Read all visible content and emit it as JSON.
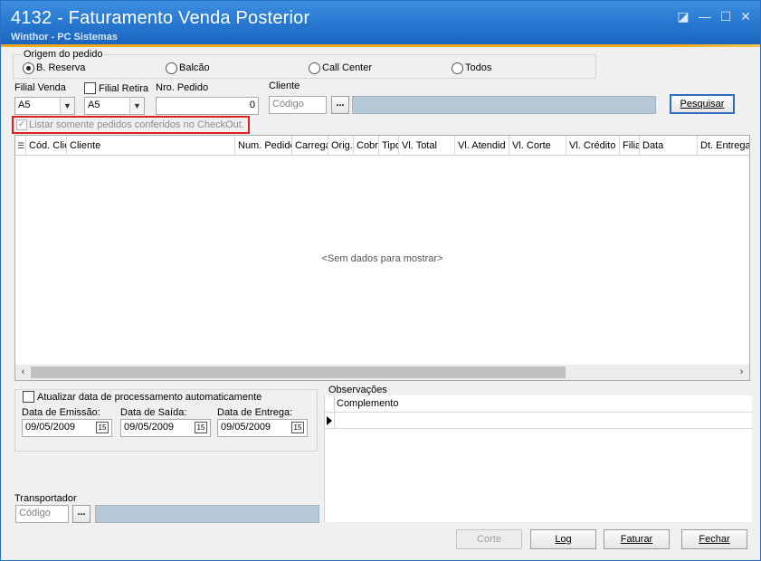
{
  "window": {
    "title": "4132 - Faturamento Venda Posterior",
    "subtitle": "Winthor - PC Sistemas",
    "controls": {
      "restore": "◪",
      "minimize": "—",
      "maximize": "☐",
      "close": "✕"
    }
  },
  "origem": {
    "legend": "Origem do pedido",
    "options": [
      {
        "label": "B. Reserva",
        "checked": true
      },
      {
        "label": "Balcão",
        "checked": false
      },
      {
        "label": "Call Center",
        "checked": false
      },
      {
        "label": "Todos",
        "checked": false
      }
    ]
  },
  "filters": {
    "filial_venda_label": "Filial Venda",
    "filial_venda_value": "A5",
    "filial_retira_label": "Filial Retira",
    "filial_retira_value": "A5",
    "nro_pedido_label": "Nro. Pedido",
    "nro_pedido_value": "0",
    "cliente_label": "Cliente",
    "cliente_placeholder": "Código",
    "ellipsis": "...",
    "pesquisar_label": "Pesquisar",
    "checkout_label": "Listar somente pedidos conferidos no CheckOut."
  },
  "grid": {
    "columns": [
      "Cód. Clie",
      "Cliente",
      "Num. Pedido",
      "Carrega",
      "Orig.",
      "Cobr",
      "Tipo",
      "Vl. Total",
      "Vl. Atendid",
      "Vl. Corte",
      "Vl. Crédito",
      "Filia",
      "Data",
      "Dt. Entrega"
    ],
    "empty_text": "<Sem dados para mostrar>",
    "scroll_left": "‹",
    "scroll_right": "›"
  },
  "dates": {
    "auto_update_label": "Atualizar data de processamento automaticamente",
    "emissao_label": "Data de Emissão:",
    "emissao_value": "09/05/2009",
    "saida_label": "Data de Saída:",
    "saida_value": "09/05/2009",
    "entrega_label": "Data de Entrega:",
    "entrega_value": "09/05/2009",
    "calendar_glyph": "15"
  },
  "observacoes": {
    "label": "Observações",
    "column": "Complemento"
  },
  "transportador": {
    "label": "Transportador",
    "placeholder": "Código",
    "ellipsis": "..."
  },
  "buttons": {
    "corte": "Corte",
    "log": "Log",
    "faturar": "Faturar",
    "fechar": "Fechar"
  },
  "colors": {
    "titlebar": "#2676cf",
    "accent": "#f3a51c",
    "highlight_box": "#e02020"
  }
}
